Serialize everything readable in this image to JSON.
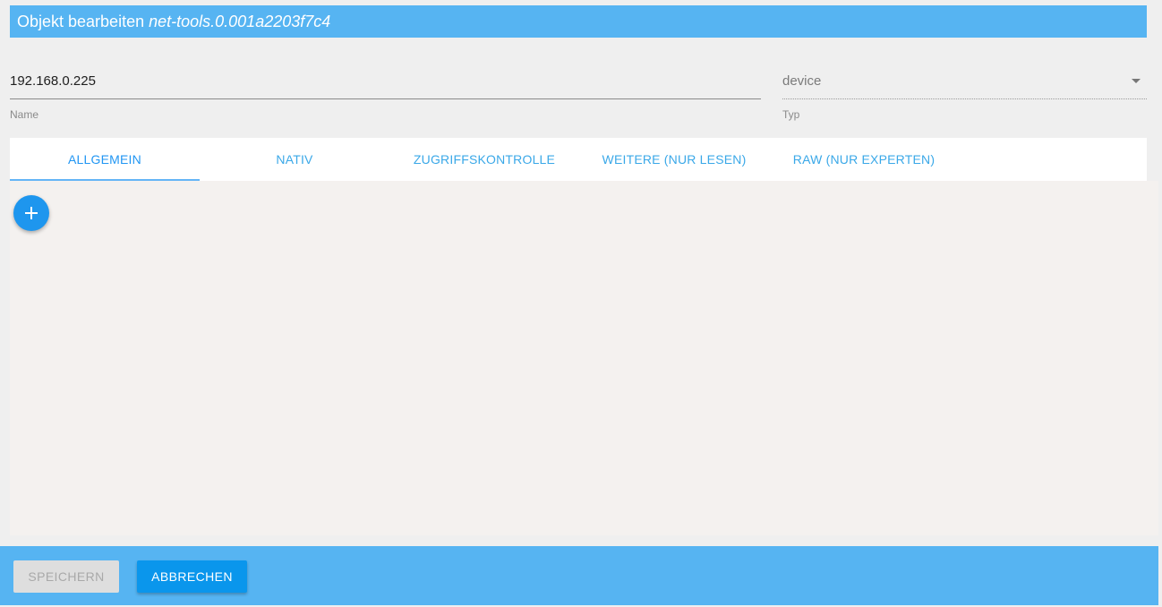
{
  "dialog": {
    "title_prefix": "Objekt bearbeiten",
    "object_id": "net-tools.0.001a2203f7c4"
  },
  "name_field": {
    "value": "192.168.0.225",
    "label": "Name"
  },
  "type_field": {
    "value": "device",
    "label": "Typ"
  },
  "tabs": [
    {
      "label": "ALLGEMEIN",
      "active": true
    },
    {
      "label": "NATIV",
      "active": false
    },
    {
      "label": "ZUGRIFFSKONTROLLE",
      "active": false
    },
    {
      "label": "WEITERE (NUR LESEN)",
      "active": false
    },
    {
      "label": "RAW (NUR EXPERTEN)",
      "active": false
    }
  ],
  "footer": {
    "save_label": "SPEICHERN",
    "cancel_label": "ABBRECHEN"
  },
  "colors": {
    "accent": "#56b4f2",
    "primary_button": "#0a96ec",
    "fab": "#1e96ee"
  },
  "icons": {
    "add": "plus-icon",
    "dropdown": "chevron-down-icon"
  }
}
